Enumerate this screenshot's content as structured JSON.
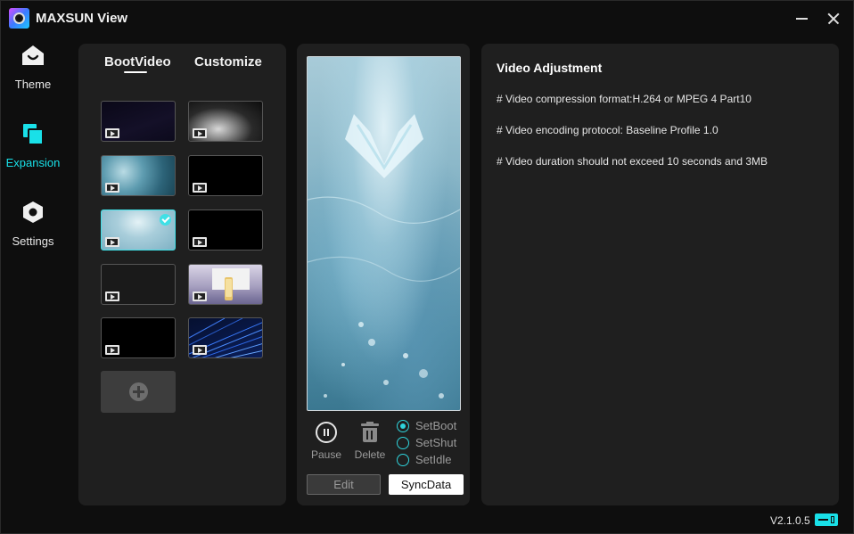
{
  "app": {
    "title": "MAXSUN View",
    "accent": "#19e0e8",
    "version": "V2.1.0.5"
  },
  "nav": {
    "items": [
      {
        "label": "Theme",
        "icon": "home-icon",
        "active": false
      },
      {
        "label": "Expansion",
        "icon": "expansion-icon",
        "active": true
      },
      {
        "label": "Settings",
        "icon": "settings-hexagon-icon",
        "active": false
      }
    ]
  },
  "tabs": [
    {
      "label": "BootVideo",
      "active": true
    },
    {
      "label": "Customize",
      "active": false
    }
  ],
  "gallery": {
    "thumbnails": [
      {
        "style": "dark-purple",
        "selected": false
      },
      {
        "style": "smoke",
        "selected": false
      },
      {
        "style": "ice-crystal",
        "selected": false
      },
      {
        "style": "black",
        "selected": false
      },
      {
        "style": "ice-frost",
        "selected": true
      },
      {
        "style": "black",
        "selected": false
      },
      {
        "style": "dark-gray",
        "selected": false
      },
      {
        "style": "product-scene",
        "selected": false
      },
      {
        "style": "black",
        "selected": false
      },
      {
        "style": "blue-lines",
        "selected": false
      }
    ],
    "add_icon": "add-circle-icon"
  },
  "player": {
    "pause_label": "Pause",
    "delete_label": "Delete",
    "radios": [
      {
        "label": "SetBoot",
        "checked": true
      },
      {
        "label": "SetShut",
        "checked": false
      },
      {
        "label": "SetIdle",
        "checked": false
      }
    ],
    "edit_label": "Edit",
    "sync_label": "SyncData"
  },
  "info": {
    "title": "Video Adjustment",
    "lines": [
      "# Video compression format:H.264 or MPEG 4 Part10",
      "# Video encoding protocol: Baseline Profile 1.0",
      "# Video duration should not exceed 10 seconds and 3MB"
    ]
  }
}
